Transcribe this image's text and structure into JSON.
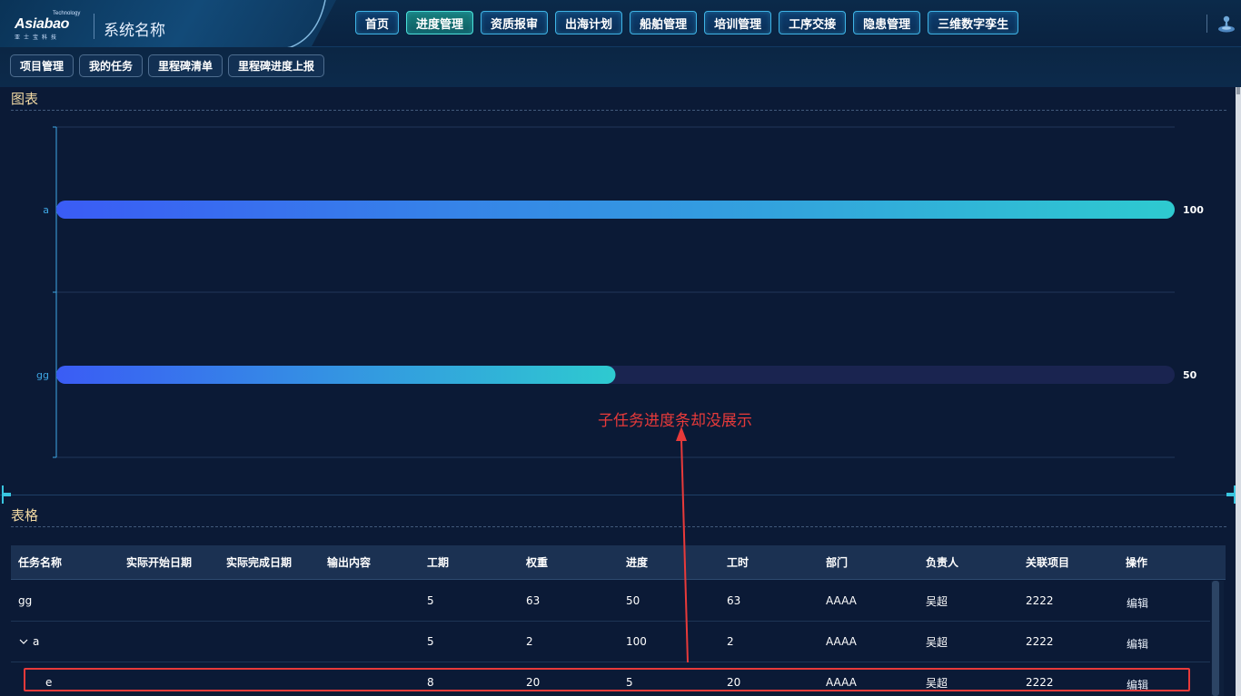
{
  "header": {
    "logo_word": "Asiabao",
    "logo_tech": "Technology",
    "logo_sub": "亚士宝科技",
    "system_name": "系统名称",
    "nav": [
      {
        "label": "首页",
        "active": false
      },
      {
        "label": "进度管理",
        "active": true
      },
      {
        "label": "资质报审",
        "active": false
      },
      {
        "label": "出海计划",
        "active": false
      },
      {
        "label": "船舶管理",
        "active": false
      },
      {
        "label": "培训管理",
        "active": false
      },
      {
        "label": "工序交接",
        "active": false
      },
      {
        "label": "隐患管理",
        "active": false
      },
      {
        "label": "三维数字孪生",
        "active": false
      }
    ],
    "user_icon": "user-icon"
  },
  "subnav": [
    "项目管理",
    "我的任务",
    "里程碑清单",
    "里程碑进度上报"
  ],
  "chart_panel": {
    "title": "图表"
  },
  "chart_data": {
    "type": "bar",
    "orientation": "horizontal",
    "categories": [
      "gg",
      "a"
    ],
    "values": [
      50,
      100
    ],
    "value_labels": [
      "50",
      "100"
    ],
    "xlim": [
      0,
      100
    ],
    "grid": true,
    "colors": {
      "gradient_start": "#3a5cf5",
      "gradient_end": "#2ecad0",
      "track": "#1a2450",
      "axis": "#3fa8e6"
    }
  },
  "annotation": {
    "text": "子任务进度条却没展示",
    "color": "#e83a3a"
  },
  "table_panel": {
    "title": "表格"
  },
  "table": {
    "columns": [
      "任务名称",
      "实际开始日期",
      "实际完成日期",
      "输出内容",
      "工期",
      "权重",
      "进度",
      "工时",
      "部门",
      "负责人",
      "关联项目",
      "操作"
    ],
    "rows": [
      {
        "name": "gg",
        "start": "",
        "end": "",
        "output": "",
        "duration": "5",
        "weight": "63",
        "progress": "50",
        "hours": "63",
        "dept": "AAAA",
        "owner": "吴超",
        "project": "2222",
        "action": "编辑",
        "expanded": false,
        "child": false
      },
      {
        "name": "a",
        "start": "",
        "end": "",
        "output": "",
        "duration": "5",
        "weight": "2",
        "progress": "100",
        "hours": "2",
        "dept": "AAAA",
        "owner": "吴超",
        "project": "2222",
        "action": "编辑",
        "expanded": true,
        "child": false
      },
      {
        "name": "e",
        "start": "",
        "end": "",
        "output": "",
        "duration": "8",
        "weight": "20",
        "progress": "5",
        "hours": "20",
        "dept": "AAAA",
        "owner": "吴超",
        "project": "2222",
        "action": "编辑",
        "expanded": false,
        "child": true
      }
    ]
  }
}
